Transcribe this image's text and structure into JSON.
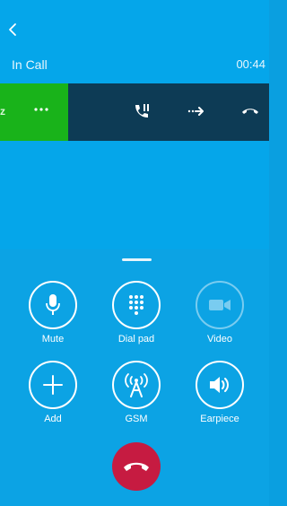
{
  "header": {
    "back_icon": "chevron-left-icon",
    "title": "In Call",
    "timer": "00:44"
  },
  "call_strip": {
    "green_panel_partial_text": "z",
    "icons": [
      "more-dots-icon",
      "call-merge-icon",
      "transfer-arrow-icon",
      "hangup-icon"
    ]
  },
  "controls": [
    {
      "label": "Mute",
      "icon": "microphone-icon",
      "enabled": true
    },
    {
      "label": "Dial pad",
      "icon": "dialpad-icon",
      "enabled": true
    },
    {
      "label": "Video",
      "icon": "video-camera-icon",
      "enabled": false
    },
    {
      "label": "Add",
      "icon": "plus-icon",
      "enabled": true
    },
    {
      "label": "GSM",
      "icon": "antenna-icon",
      "enabled": true
    },
    {
      "label": "Earpiece",
      "icon": "speaker-icon",
      "enabled": true
    }
  ],
  "end_call": {
    "icon": "end-call-icon"
  },
  "colors": {
    "background": "#05a6ea",
    "strip": "#0d3b55",
    "green": "#19b31a",
    "end_call": "#c61b41"
  }
}
